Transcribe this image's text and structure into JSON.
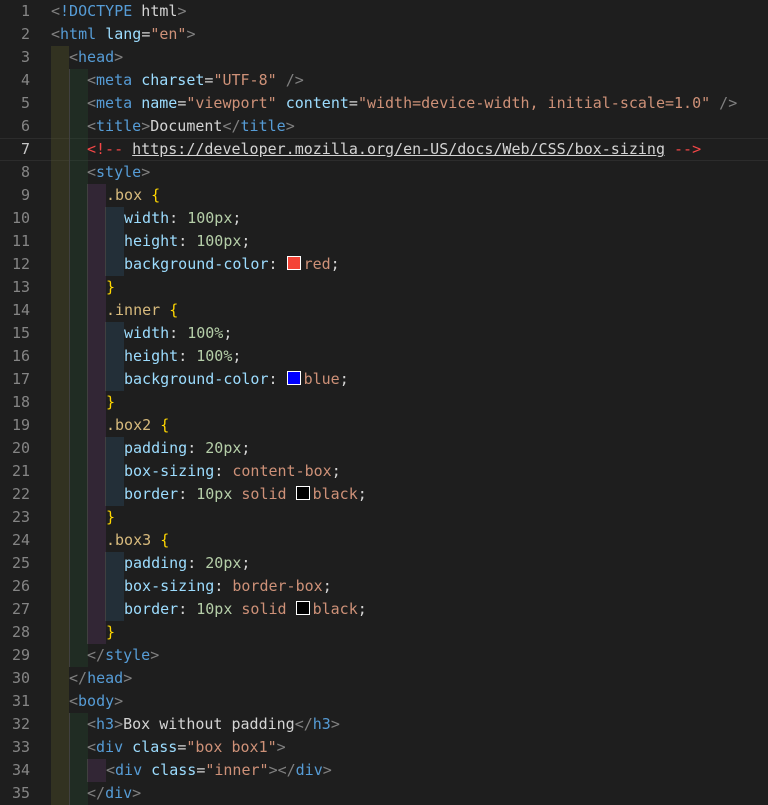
{
  "editor": {
    "colors": {
      "background": "#1e1e1e",
      "tag": "#569cd6",
      "attribute": "#9cdcfe",
      "string": "#ce9178",
      "selector": "#d7ba7d",
      "number": "#b5cea8",
      "brace": "#ffd700"
    },
    "active_line": 7,
    "lines": [
      {
        "n": "1",
        "indent": 0,
        "tokens": [
          [
            "punc",
            "<"
          ],
          [
            "tag",
            "!DOCTYPE"
          ],
          [
            "txt",
            " html"
          ],
          [
            "punc",
            ">"
          ]
        ]
      },
      {
        "n": "2",
        "indent": 0,
        "tokens": [
          [
            "punc",
            "<"
          ],
          [
            "tag",
            "html"
          ],
          [
            "txt",
            " "
          ],
          [
            "attr",
            "lang"
          ],
          [
            "txt",
            "="
          ],
          [
            "str",
            "\"en\""
          ],
          [
            "punc",
            ">"
          ]
        ]
      },
      {
        "n": "3",
        "indent": 1,
        "tokens": [
          [
            "punc",
            "<"
          ],
          [
            "tag",
            "head"
          ],
          [
            "punc",
            ">"
          ]
        ]
      },
      {
        "n": "4",
        "indent": 2,
        "tokens": [
          [
            "punc",
            "<"
          ],
          [
            "tag",
            "meta"
          ],
          [
            "txt",
            " "
          ],
          [
            "attr",
            "charset"
          ],
          [
            "txt",
            "="
          ],
          [
            "str",
            "\"UTF-8\""
          ],
          [
            "txt",
            " "
          ],
          [
            "punc",
            "/>"
          ]
        ]
      },
      {
        "n": "5",
        "indent": 2,
        "tokens": [
          [
            "punc",
            "<"
          ],
          [
            "tag",
            "meta"
          ],
          [
            "txt",
            " "
          ],
          [
            "attr",
            "name"
          ],
          [
            "txt",
            "="
          ],
          [
            "str",
            "\"viewport\""
          ],
          [
            "txt",
            " "
          ],
          [
            "attr",
            "content"
          ],
          [
            "txt",
            "="
          ],
          [
            "str",
            "\"width=device-width, initial-scale=1.0\""
          ],
          [
            "txt",
            " "
          ],
          [
            "punc",
            "/>"
          ]
        ]
      },
      {
        "n": "6",
        "indent": 2,
        "tokens": [
          [
            "punc",
            "<"
          ],
          [
            "tag",
            "title"
          ],
          [
            "punc",
            ">"
          ],
          [
            "txt",
            "Document"
          ],
          [
            "punc",
            "</"
          ],
          [
            "tag",
            "title"
          ],
          [
            "punc",
            ">"
          ]
        ]
      },
      {
        "n": "7",
        "indent": 2,
        "tokens": [
          [
            "redmark",
            "<!-- "
          ],
          [
            "link",
            "https://developer.mozilla.org/en-US/docs/Web/CSS/box-sizing"
          ],
          [
            "redmark",
            " -->"
          ]
        ]
      },
      {
        "n": "8",
        "indent": 2,
        "tokens": [
          [
            "punc",
            "<"
          ],
          [
            "tag",
            "style"
          ],
          [
            "punc",
            ">"
          ]
        ]
      },
      {
        "n": "9",
        "indent": 3,
        "tokens": [
          [
            "sel",
            ".box"
          ],
          [
            "txt",
            " "
          ],
          [
            "brace",
            "{"
          ]
        ]
      },
      {
        "n": "10",
        "indent": 4,
        "tokens": [
          [
            "prop",
            "width"
          ],
          [
            "txt",
            ": "
          ],
          [
            "num",
            "100px"
          ],
          [
            "txt",
            ";"
          ]
        ]
      },
      {
        "n": "11",
        "indent": 4,
        "tokens": [
          [
            "prop",
            "height"
          ],
          [
            "txt",
            ": "
          ],
          [
            "num",
            "100px"
          ],
          [
            "txt",
            ";"
          ]
        ]
      },
      {
        "n": "12",
        "indent": 4,
        "tokens": [
          [
            "prop",
            "background-color"
          ],
          [
            "txt",
            ": "
          ],
          [
            "swatch",
            "#f44336"
          ],
          [
            "val",
            "red"
          ],
          [
            "txt",
            ";"
          ]
        ]
      },
      {
        "n": "13",
        "indent": 3,
        "tokens": [
          [
            "brace",
            "}"
          ]
        ]
      },
      {
        "n": "14",
        "indent": 3,
        "tokens": [
          [
            "sel",
            ".inner"
          ],
          [
            "txt",
            " "
          ],
          [
            "brace",
            "{"
          ]
        ]
      },
      {
        "n": "15",
        "indent": 4,
        "tokens": [
          [
            "prop",
            "width"
          ],
          [
            "txt",
            ": "
          ],
          [
            "num",
            "100%"
          ],
          [
            "txt",
            ";"
          ]
        ]
      },
      {
        "n": "16",
        "indent": 4,
        "tokens": [
          [
            "prop",
            "height"
          ],
          [
            "txt",
            ": "
          ],
          [
            "num",
            "100%"
          ],
          [
            "txt",
            ";"
          ]
        ]
      },
      {
        "n": "17",
        "indent": 4,
        "tokens": [
          [
            "prop",
            "background-color"
          ],
          [
            "txt",
            ": "
          ],
          [
            "swatch",
            "#0000ff"
          ],
          [
            "val",
            "blue"
          ],
          [
            "txt",
            ";"
          ]
        ]
      },
      {
        "n": "18",
        "indent": 3,
        "tokens": [
          [
            "brace",
            "}"
          ]
        ]
      },
      {
        "n": "19",
        "indent": 3,
        "tokens": [
          [
            "sel",
            ".box2"
          ],
          [
            "txt",
            " "
          ],
          [
            "brace",
            "{"
          ]
        ]
      },
      {
        "n": "20",
        "indent": 4,
        "tokens": [
          [
            "prop",
            "padding"
          ],
          [
            "txt",
            ": "
          ],
          [
            "num",
            "20px"
          ],
          [
            "txt",
            ";"
          ]
        ]
      },
      {
        "n": "21",
        "indent": 4,
        "tokens": [
          [
            "prop",
            "box-sizing"
          ],
          [
            "txt",
            ": "
          ],
          [
            "val",
            "content-box"
          ],
          [
            "txt",
            ";"
          ]
        ]
      },
      {
        "n": "22",
        "indent": 4,
        "tokens": [
          [
            "prop",
            "border"
          ],
          [
            "txt",
            ": "
          ],
          [
            "num",
            "10px"
          ],
          [
            "txt",
            " "
          ],
          [
            "val",
            "solid"
          ],
          [
            "txt",
            " "
          ],
          [
            "swatch",
            "#000000"
          ],
          [
            "val",
            "black"
          ],
          [
            "txt",
            ";"
          ]
        ]
      },
      {
        "n": "23",
        "indent": 3,
        "tokens": [
          [
            "brace",
            "}"
          ]
        ]
      },
      {
        "n": "24",
        "indent": 3,
        "tokens": [
          [
            "sel",
            ".box3"
          ],
          [
            "txt",
            " "
          ],
          [
            "brace",
            "{"
          ]
        ]
      },
      {
        "n": "25",
        "indent": 4,
        "tokens": [
          [
            "prop",
            "padding"
          ],
          [
            "txt",
            ": "
          ],
          [
            "num",
            "20px"
          ],
          [
            "txt",
            ";"
          ]
        ]
      },
      {
        "n": "26",
        "indent": 4,
        "tokens": [
          [
            "prop",
            "box-sizing"
          ],
          [
            "txt",
            ": "
          ],
          [
            "val",
            "border-box"
          ],
          [
            "txt",
            ";"
          ]
        ]
      },
      {
        "n": "27",
        "indent": 4,
        "tokens": [
          [
            "prop",
            "border"
          ],
          [
            "txt",
            ": "
          ],
          [
            "num",
            "10px"
          ],
          [
            "txt",
            " "
          ],
          [
            "val",
            "solid"
          ],
          [
            "txt",
            " "
          ],
          [
            "swatch",
            "#000000"
          ],
          [
            "val",
            "black"
          ],
          [
            "txt",
            ";"
          ]
        ]
      },
      {
        "n": "28",
        "indent": 3,
        "tokens": [
          [
            "brace",
            "}"
          ]
        ]
      },
      {
        "n": "29",
        "indent": 2,
        "tokens": [
          [
            "punc",
            "</"
          ],
          [
            "tag",
            "style"
          ],
          [
            "punc",
            ">"
          ]
        ]
      },
      {
        "n": "30",
        "indent": 1,
        "tokens": [
          [
            "punc",
            "</"
          ],
          [
            "tag",
            "head"
          ],
          [
            "punc",
            ">"
          ]
        ]
      },
      {
        "n": "31",
        "indent": 1,
        "tokens": [
          [
            "punc",
            "<"
          ],
          [
            "tag",
            "body"
          ],
          [
            "punc",
            ">"
          ]
        ]
      },
      {
        "n": "32",
        "indent": 2,
        "tokens": [
          [
            "punc",
            "<"
          ],
          [
            "tag",
            "h3"
          ],
          [
            "punc",
            ">"
          ],
          [
            "txt",
            "Box without padding"
          ],
          [
            "punc",
            "</"
          ],
          [
            "tag",
            "h3"
          ],
          [
            "punc",
            ">"
          ]
        ]
      },
      {
        "n": "33",
        "indent": 2,
        "tokens": [
          [
            "punc",
            "<"
          ],
          [
            "tag",
            "div"
          ],
          [
            "txt",
            " "
          ],
          [
            "attr",
            "class"
          ],
          [
            "txt",
            "="
          ],
          [
            "str",
            "\"box box1\""
          ],
          [
            "punc",
            ">"
          ]
        ]
      },
      {
        "n": "34",
        "indent": 3,
        "tokens": [
          [
            "punc",
            "<"
          ],
          [
            "tag",
            "div"
          ],
          [
            "txt",
            " "
          ],
          [
            "attr",
            "class"
          ],
          [
            "txt",
            "="
          ],
          [
            "str",
            "\"inner\""
          ],
          [
            "punc",
            "></"
          ],
          [
            "tag",
            "div"
          ],
          [
            "punc",
            ">"
          ]
        ]
      },
      {
        "n": "35",
        "indent": 2,
        "tokens": [
          [
            "punc",
            "</"
          ],
          [
            "tag",
            "div"
          ],
          [
            "punc",
            ">"
          ]
        ]
      }
    ]
  }
}
